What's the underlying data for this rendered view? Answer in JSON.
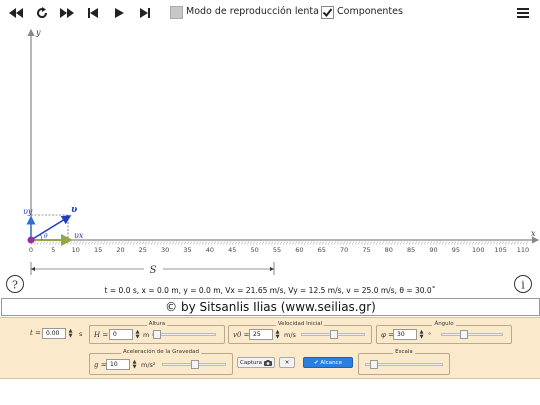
{
  "toolbar": {
    "buttons": [
      {
        "name": "rewind-button",
        "icon": "rewind-icon"
      },
      {
        "name": "reset-button",
        "icon": "reload-icon"
      },
      {
        "name": "fast-forward-button",
        "icon": "fast-forward-icon"
      },
      {
        "name": "step-back-button",
        "icon": "skip-back-icon"
      },
      {
        "name": "play-button",
        "icon": "play-icon"
      },
      {
        "name": "step-forward-button",
        "icon": "skip-forward-icon"
      }
    ],
    "slow_mode_label": "Modo de reproducción lenta",
    "slow_mode_checked": false,
    "components_label": "Componentes",
    "components_checked": true,
    "menu_icon": "hamburger-menu-icon"
  },
  "sim": {
    "y_axis_label": "y",
    "x_axis_label": "x",
    "x_ticks": [
      "0",
      "5",
      "10",
      "15",
      "20",
      "25",
      "30",
      "35",
      "40",
      "45",
      "50",
      "55",
      "60",
      "65",
      "70",
      "75",
      "80",
      "85",
      "90",
      "95",
      "100",
      "105",
      "110"
    ],
    "vector_labels": {
      "v": "υ",
      "vx": "υx",
      "vy": "υy",
      "theta": "θ"
    },
    "range_label": "S",
    "help_icon": "?",
    "info_icon": "i"
  },
  "status": "t = 0.0 s, x = 0.0 m, y = 0.0 m, Vx = 21.65 m/s, Vy = 12.5 m/s, v = 25.0 m/s, θ = 30.0˚",
  "credit": "© by Sitsanlis Ilias (www.seilias.gr)",
  "controls": {
    "time": {
      "label": "t =",
      "value": "0.00",
      "unit": "s"
    },
    "height": {
      "title": "Altura",
      "label": "H =",
      "value": "0",
      "unit": "m",
      "fraction": 0.0
    },
    "velocity": {
      "title": "Velocidad Inicial",
      "label": "v0 =",
      "value": "25",
      "unit": "m/s",
      "fraction": 0.5
    },
    "angle": {
      "title": "Ángulo",
      "label": "φ =",
      "value": "30",
      "unit": "°",
      "fraction": 0.33
    },
    "gravity": {
      "title": "Aceleración de la Gravedad",
      "label": "g =",
      "value": "10",
      "unit": "m/s²",
      "fraction": 0.5
    },
    "capture_label": "Captura",
    "capture_icon": "camera-icon",
    "clear_label": "✕",
    "range_button_label": "✔ Alcance",
    "scale": {
      "title": "Escala",
      "fraction": 0.05
    }
  },
  "colors": {
    "axis": "#888888",
    "velocity_vector": "#1f3fbf",
    "vx_vector": "#8fa84a",
    "vy_vector": "#2f6fd8",
    "ball": "#9b2fa0",
    "panel_bg": "#fbe9cc",
    "primary_button": "#2a7fe0"
  }
}
